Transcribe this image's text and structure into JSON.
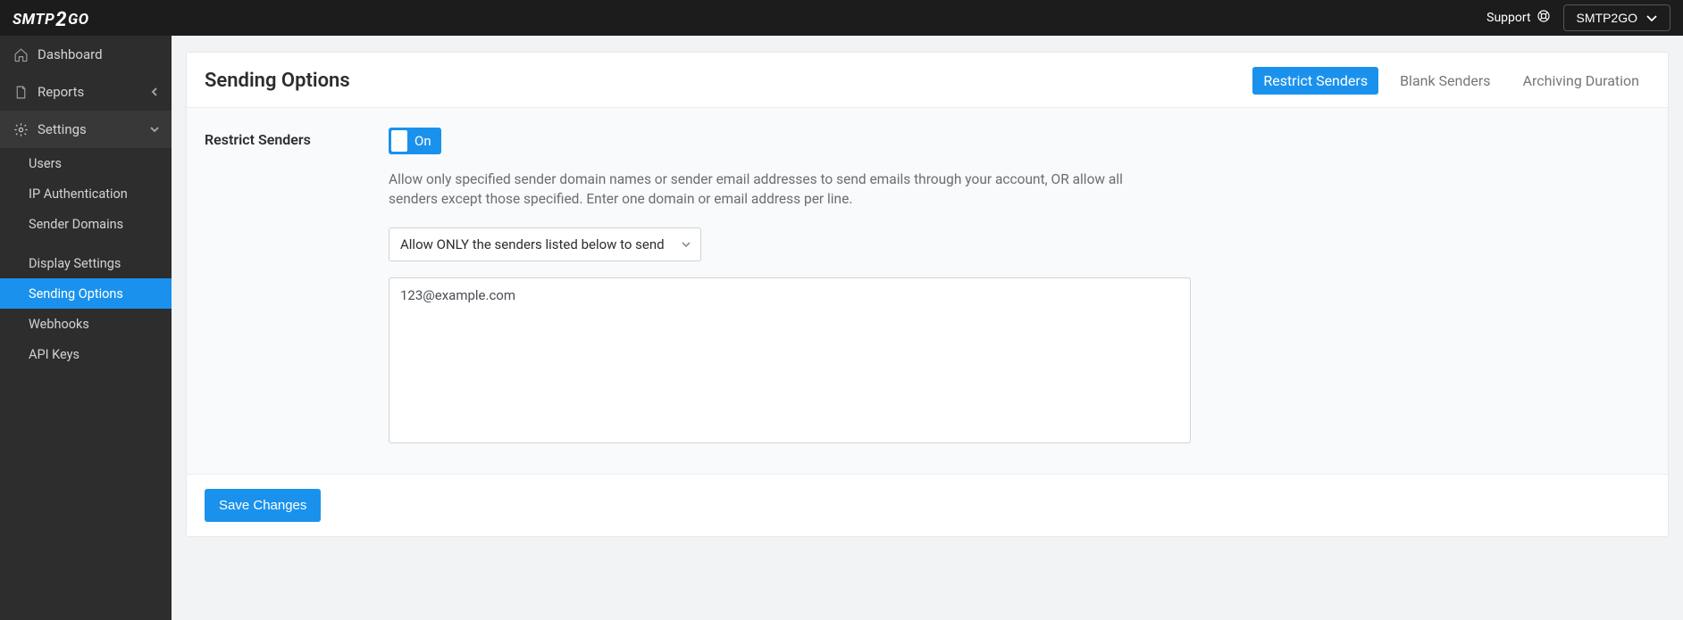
{
  "logo_text": "SMTP2GO",
  "topbar": {
    "support": "Support",
    "account": "SMTP2GO"
  },
  "sidebar": {
    "items": [
      {
        "label": "Dashboard"
      },
      {
        "label": "Reports"
      },
      {
        "label": "Settings"
      }
    ],
    "settings_children_a": [
      {
        "label": "Users"
      },
      {
        "label": "IP Authentication"
      },
      {
        "label": "Sender Domains"
      }
    ],
    "settings_children_b": [
      {
        "label": "Display Settings"
      },
      {
        "label": "Sending Options"
      },
      {
        "label": "Webhooks"
      },
      {
        "label": "API Keys"
      }
    ]
  },
  "page": {
    "title": "Sending Options",
    "tabs": [
      {
        "label": "Restrict Senders",
        "active": true
      },
      {
        "label": "Blank Senders"
      },
      {
        "label": "Archiving Duration"
      }
    ]
  },
  "restrict": {
    "label": "Restrict Senders",
    "toggle_state": "On",
    "help": "Allow only specified sender domain names or sender email addresses to send emails through your account, OR allow all senders except those specified. Enter one domain or email address per line.",
    "mode_select": "Allow ONLY the senders listed below to send",
    "senders_value": "123@example.com"
  },
  "footer": {
    "save": "Save Changes"
  }
}
